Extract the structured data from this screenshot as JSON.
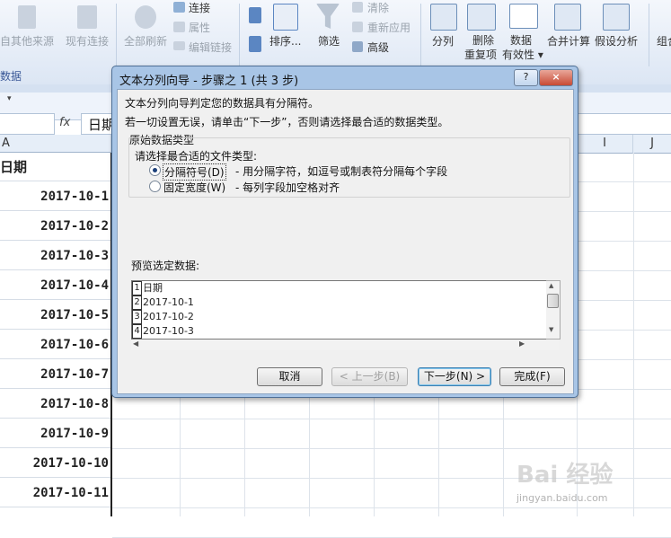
{
  "ribbon": {
    "other_sources": "自其他来源",
    "existing_connections": "现有连接",
    "refresh_all": "全部刷新",
    "connections": "连接",
    "properties": "属性",
    "edit_links": "编辑链接",
    "sort": "排序...",
    "filter": "筛选",
    "clear": "清除",
    "reapply": "重新应用",
    "advanced": "高级",
    "split_columns": "分列",
    "remove_duplicates_1": "删除",
    "remove_duplicates_2": "重复项",
    "data_validity_1": "数据",
    "data_validity_2": "有效性",
    "consolidate": "合并计算",
    "what_if": "假设分析",
    "group": "组合",
    "group_label_data": "数据"
  },
  "formula_bar": {
    "fx": "fx",
    "value": "日期",
    "name_box": ""
  },
  "columns": {
    "a": "A",
    "i": "I",
    "j": "J"
  },
  "sheet": {
    "header": "日期",
    "dates": [
      "2017-10-1",
      "2017-10-2",
      "2017-10-3",
      "2017-10-4",
      "2017-10-5",
      "2017-10-6",
      "2017-10-7",
      "2017-10-8",
      "2017-10-9",
      "2017-10-10",
      "2017-10-11"
    ]
  },
  "dialog": {
    "title": "文本分列向导 - 步骤之 1 (共 3 步)",
    "help_btn": "?",
    "close_btn": "×",
    "line1": "文本分列向导判定您的数据具有分隔符。",
    "line2": "若一切设置无误，请单击“下一步”，否则请选择最合适的数据类型。",
    "group_title": "原始数据类型",
    "choose_type": "请选择最合适的文件类型:",
    "option_delimited": "分隔符号(D)",
    "option_delimited_desc": "- 用分隔字符，如逗号或制表符分隔每个字段",
    "option_fixed": "固定宽度(W)",
    "option_fixed_desc": "- 每列字段加空格对齐",
    "preview_label": "预览选定数据:",
    "preview_rows": [
      {
        "num": "1",
        "text": "日期"
      },
      {
        "num": "2",
        "text": "2017-10-1"
      },
      {
        "num": "3",
        "text": "2017-10-2"
      },
      {
        "num": "4",
        "text": "2017-10-3"
      }
    ],
    "btn_cancel": "取消",
    "btn_back": "< 上一步(B)",
    "btn_next": "下一步(N) >",
    "btn_finish": "完成(F)"
  },
  "watermark": {
    "brand": "Bai 经验",
    "url": "jingyan.baidu.com"
  }
}
